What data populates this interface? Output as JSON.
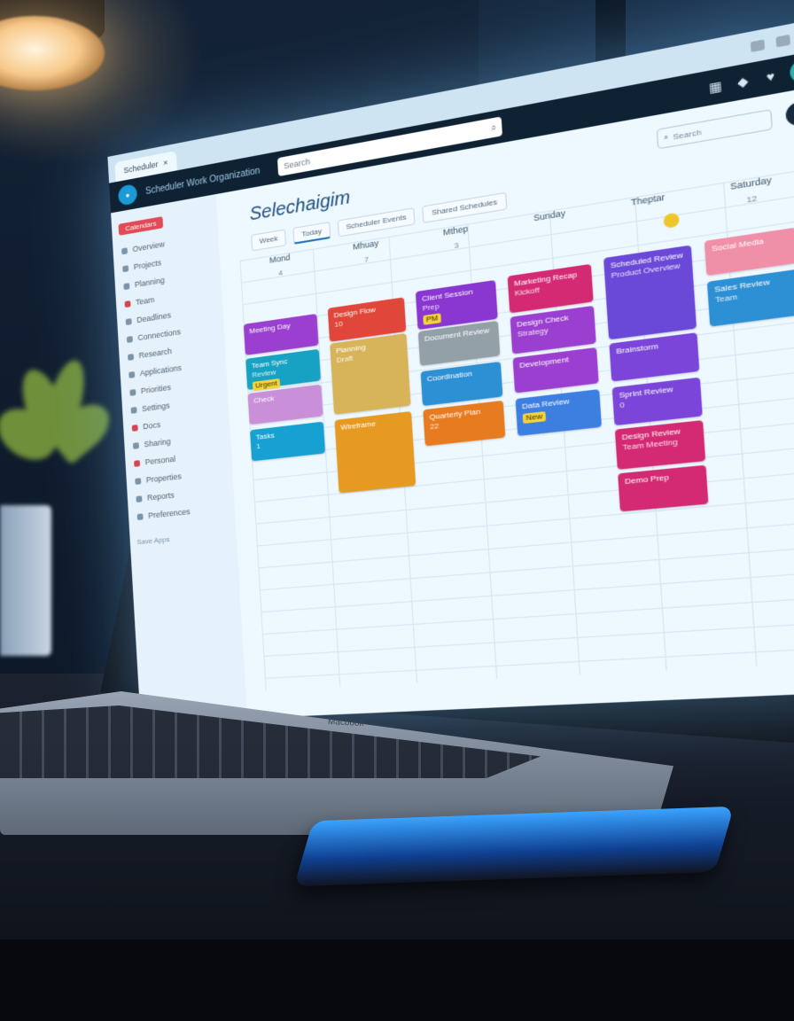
{
  "scene": {
    "lamp_glow": "#f7c98a",
    "screen_glow": "#78c8ff",
    "laptop_label": "Macbook"
  },
  "browser": {
    "tab_title": "Scheduler",
    "close_icon": "close-icon"
  },
  "app": {
    "name": "Scheduler Work Organization",
    "search_placeholder": "Search"
  },
  "sidebar": {
    "badge": "Calendars",
    "items": [
      {
        "label": "Overview"
      },
      {
        "label": "Projects"
      },
      {
        "label": "Planning"
      },
      {
        "label": "Team"
      },
      {
        "label": "Deadlines"
      },
      {
        "label": "Connections"
      },
      {
        "label": "Research"
      },
      {
        "label": "Applications"
      },
      {
        "label": "Priorities"
      },
      {
        "label": "Settings"
      },
      {
        "label": "Docs"
      },
      {
        "label": "Sharing"
      },
      {
        "label": "Personal"
      },
      {
        "label": "Properties"
      },
      {
        "label": "Reports"
      },
      {
        "label": "Preferences"
      }
    ],
    "footer": "Save Apps"
  },
  "main": {
    "title": "Selechaigim",
    "search_placeholder": "Search",
    "toolbar": [
      "Week",
      "Today",
      "Scheduler Events",
      "Shared Schedules"
    ],
    "columns": [
      {
        "label": "Mond",
        "num": "4"
      },
      {
        "label": "Mhuay",
        "num": "7"
      },
      {
        "label": "Mthep",
        "num": "3"
      },
      {
        "label": "Sunday",
        "num": ""
      },
      {
        "label": "Theptar",
        "num": ""
      },
      {
        "label": "Saturday",
        "num": "12"
      }
    ]
  },
  "events": [
    {
      "title": "Meeting Day",
      "sub": "",
      "color": "#9b3fd0"
    },
    {
      "title": "Team Sync",
      "sub": "Review",
      "tag": "Urgent",
      "color": "#17a2c4"
    },
    {
      "title": "Check",
      "sub": "",
      "color": "#c98fd9"
    },
    {
      "title": "Tasks",
      "sub": "1",
      "color": "#16a1d2"
    },
    {
      "title": "Design Flow",
      "sub": "10",
      "color": "#e0463a"
    },
    {
      "title": "Planning",
      "sub": "Draft",
      "color": "#d7b35a"
    },
    {
      "title": "Wireframe",
      "sub": "",
      "color": "#e79a22"
    },
    {
      "title": "Client Session",
      "sub": "Prep",
      "tag": "PM",
      "color": "#8a36d1"
    },
    {
      "title": "Document Review",
      "sub": "",
      "color": "#93a0a8"
    },
    {
      "title": "Coordination",
      "sub": "",
      "color": "#2d8fd4"
    },
    {
      "title": "Quarterly Plan",
      "sub": "22",
      "color": "#e77b1f"
    },
    {
      "title": "Marketing Recap",
      "sub": "Kickoff",
      "color": "#d42a73"
    },
    {
      "title": "Design Check",
      "sub": "Strategy",
      "color": "#9b3fd0"
    },
    {
      "title": "Development",
      "sub": "",
      "color": "#9b3fd0"
    },
    {
      "title": "Data Review",
      "sub": "",
      "tag": "New",
      "color": "#3d7fe0"
    },
    {
      "title": "Scheduled Review",
      "sub": "Product Overview",
      "color": "#6b49d8"
    },
    {
      "title": "Brainstorm",
      "sub": "",
      "color": "#7a45d8"
    },
    {
      "title": "Sprint Review",
      "sub": "0",
      "color": "#7a45d8"
    },
    {
      "title": "Design Review",
      "sub": "Team Meeting",
      "color": "#d42a73"
    },
    {
      "title": "Demo Prep",
      "sub": "",
      "color": "#d42a73"
    },
    {
      "title": "Social Media",
      "sub": "",
      "color": "#f08fa8"
    },
    {
      "title": "Sales Review",
      "sub": "Team",
      "color": "#2d8fd4"
    }
  ]
}
